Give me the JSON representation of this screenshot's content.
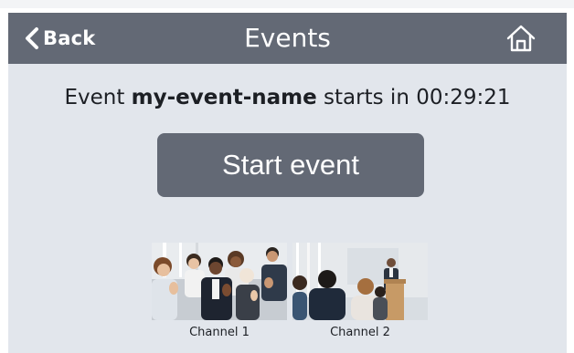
{
  "header": {
    "back_label": "Back",
    "title": "Events",
    "back_icon": "chevron-left-icon",
    "home_icon": "home-icon"
  },
  "event": {
    "prefix": "Event ",
    "name": "my-event-name",
    "middle": " starts in ",
    "countdown": "00:29:21"
  },
  "start_button_label": "Start event",
  "channels": [
    {
      "label": "Channel 1"
    },
    {
      "label": "Channel 2"
    }
  ],
  "colors": {
    "header_bg": "#636975",
    "panel_bg": "#e2e6ec",
    "button_bg": "#636975",
    "text": "#1c1f24"
  }
}
